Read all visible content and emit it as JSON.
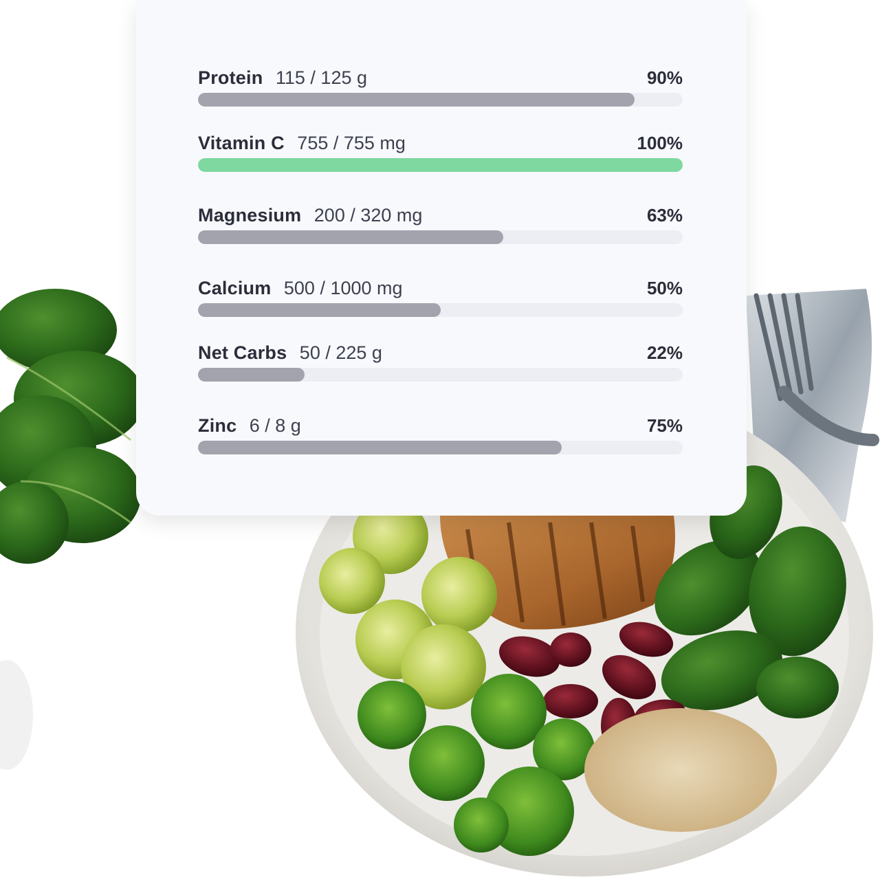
{
  "nutrients": [
    {
      "name": "Protein",
      "amount": "115 / 125 g",
      "percent": "90%",
      "fill_fraction": 0.9,
      "bar_color": "#a2a3ad"
    },
    {
      "name": "Vitamin C",
      "amount": "755 / 755 mg",
      "percent": "100%",
      "fill_fraction": 1.0,
      "bar_color": "#7ed8a0"
    },
    {
      "name": "Magnesium",
      "amount": "200 / 320 mg",
      "percent": "63%",
      "fill_fraction": 0.63,
      "bar_color": "#a2a3ad"
    },
    {
      "name": "Calcium",
      "amount": "500 / 1000 mg",
      "percent": "50%",
      "fill_fraction": 0.5,
      "bar_color": "#a2a3ad"
    },
    {
      "name": "Net Carbs",
      "amount": "50 / 225 g",
      "percent": "22%",
      "fill_fraction": 0.22,
      "bar_color": "#a2a3ad"
    },
    {
      "name": "Zinc",
      "amount": "6 / 8 g",
      "percent": "75%",
      "fill_fraction": 0.75,
      "bar_color": "#a2a3ad"
    }
  ],
  "colors": {
    "card_background": "#f8f9fc",
    "track": "#eceef4",
    "default_fill": "#a2a3ad",
    "complete_fill": "#7ed8a0",
    "text_dark": "#2b2e3a"
  }
}
